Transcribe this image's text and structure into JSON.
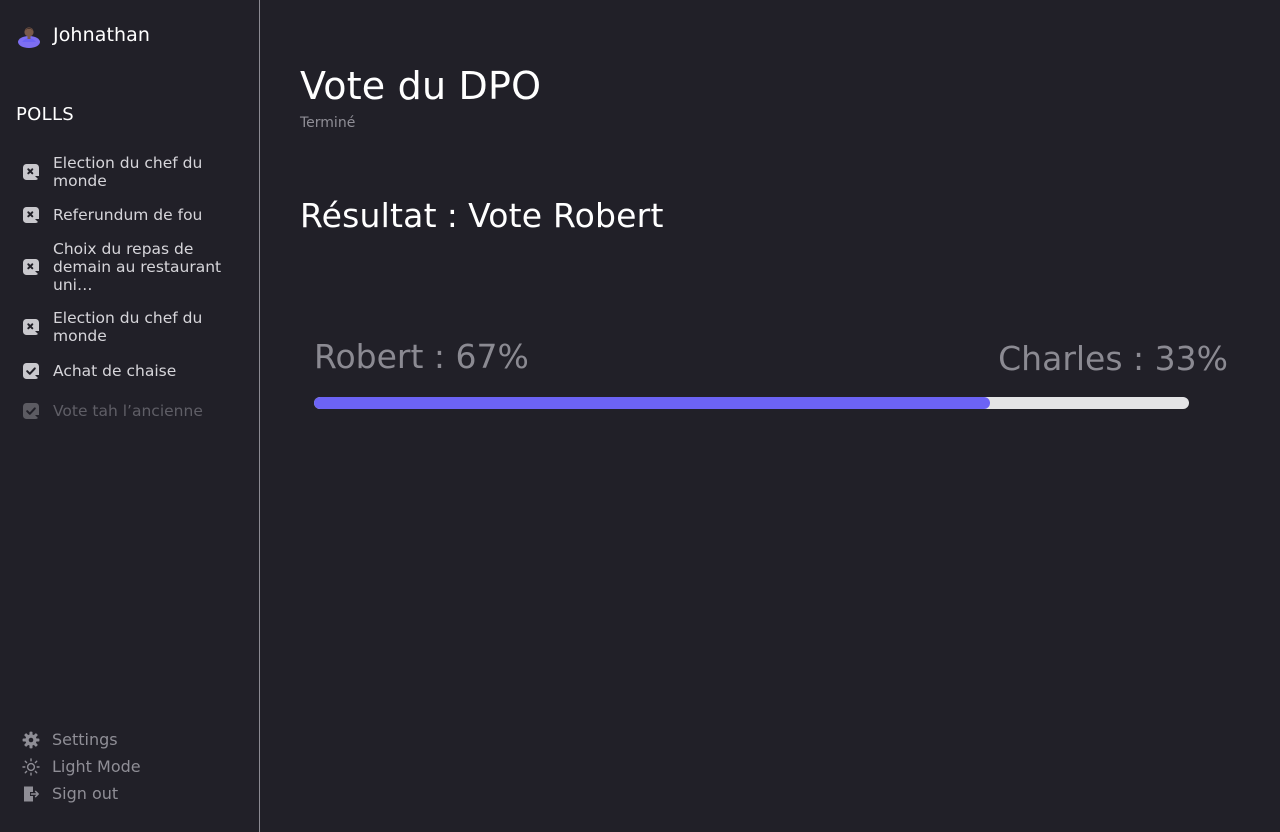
{
  "user": {
    "name": "Johnathan",
    "avatar_icon": "user-avatar-icon"
  },
  "sidebar": {
    "polls_heading": "POLLS",
    "polls": [
      {
        "label": "Election du chef du monde",
        "icon": "x-badge-icon",
        "status": "closed"
      },
      {
        "label": "Referundum de fou",
        "icon": "x-badge-icon",
        "status": "closed"
      },
      {
        "label": "Choix du repas de demain au restaurant uni…",
        "icon": "x-badge-icon",
        "status": "closed"
      },
      {
        "label": "Election du chef du monde",
        "icon": "x-badge-icon",
        "status": "closed"
      },
      {
        "label": "Achat de chaise",
        "icon": "check-badge-icon",
        "status": "voted"
      },
      {
        "label": "Vote tah l’ancienne",
        "icon": "check-badge-icon",
        "status": "disabled"
      }
    ],
    "bottom_menu": [
      {
        "label": "Settings",
        "icon": "gear-icon"
      },
      {
        "label": "Light Mode",
        "icon": "sun-icon"
      },
      {
        "label": "Sign out",
        "icon": "sign-out-icon"
      }
    ]
  },
  "main": {
    "title": "Vote du DPO",
    "status": "Terminé",
    "result_label": "Résultat",
    "result_separator": ":",
    "result_value": "Vote Robert",
    "options": {
      "left": "Robert : 67%",
      "right": "Charles : 33%"
    },
    "bar_fill_fraction": 0.773
  },
  "colors": {
    "background": "#212028",
    "accent": "#6c63f5",
    "track": "#e4e4e6",
    "muted": "#8f8e96"
  }
}
